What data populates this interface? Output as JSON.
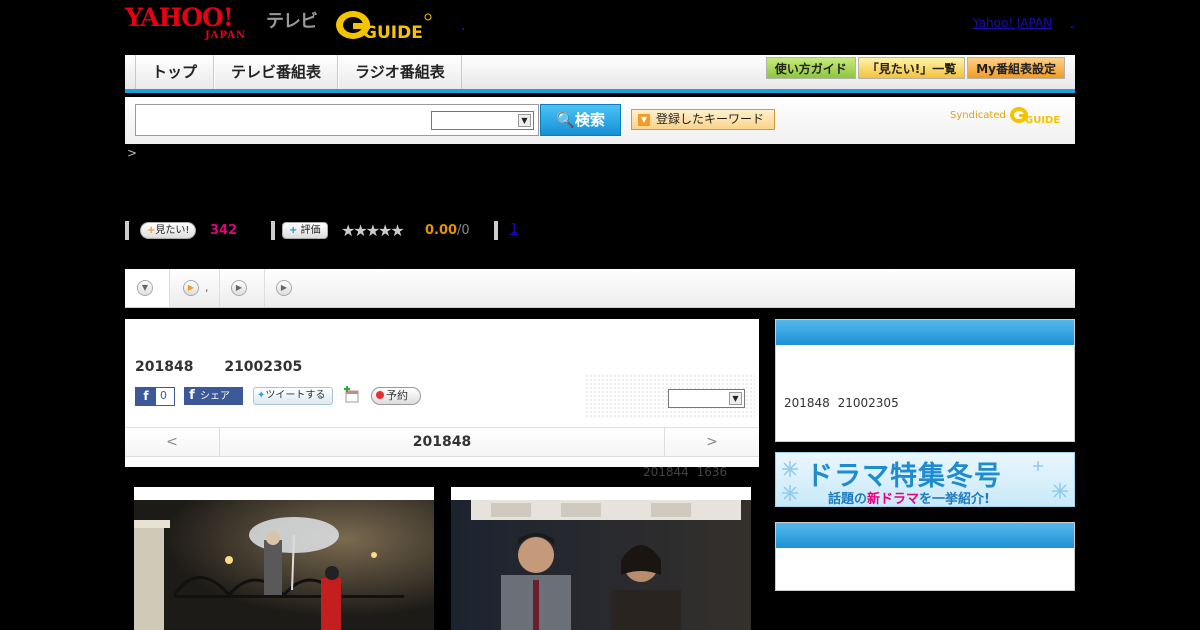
{
  "header": {
    "yahoo_logo": "YAHOO!",
    "yahoo_sub": "JAPAN",
    "tv_label": "テレビ",
    "gguide_logo": "G-GUIDE",
    "yahoo_japan_link": "Yahoo! JAPAN"
  },
  "nav": {
    "tabs": [
      "トップ",
      "テレビ番組表",
      "ラジオ番組表"
    ],
    "right_buttons": [
      "使い方ガイド",
      "「見たい!」一覧",
      "My番組表設定"
    ]
  },
  "search": {
    "input_value": "",
    "select_value": "",
    "button_label": "検索",
    "keyword_button": "登録したキーワード",
    "syndicated": "Syndicated"
  },
  "breadcrumb": ">",
  "stats": {
    "want_label": "見たい!",
    "want_count": "342",
    "rate_label": "評価",
    "stars": "★★★★★",
    "score": "0.00",
    "score_count": "/0",
    "review_link": "1"
  },
  "tabstrip": {
    "tab2_text": ","
  },
  "main": {
    "date_line": "201848 21002305",
    "fb_count": "0",
    "fb_share": "シェア",
    "tweet": "ツイートする",
    "reserve": "予約",
    "select_value": "",
    "pager_prev": "<",
    "pager_current": "201848",
    "pager_next": ">",
    "updated": "201844 1636"
  },
  "sidebar": {
    "info_text": "201848 21002305",
    "banner_title": "ドラマ特集冬号",
    "banner_sub_a": "話題の",
    "banner_sub_b": "新ドラマ",
    "banner_sub_c": "を一挙紹介!"
  },
  "colors": {
    "accent_blue": "#1ea0e0",
    "want_pink": "#e4007f",
    "score_orange": "#e69300",
    "yahoo_red": "#e60012"
  }
}
